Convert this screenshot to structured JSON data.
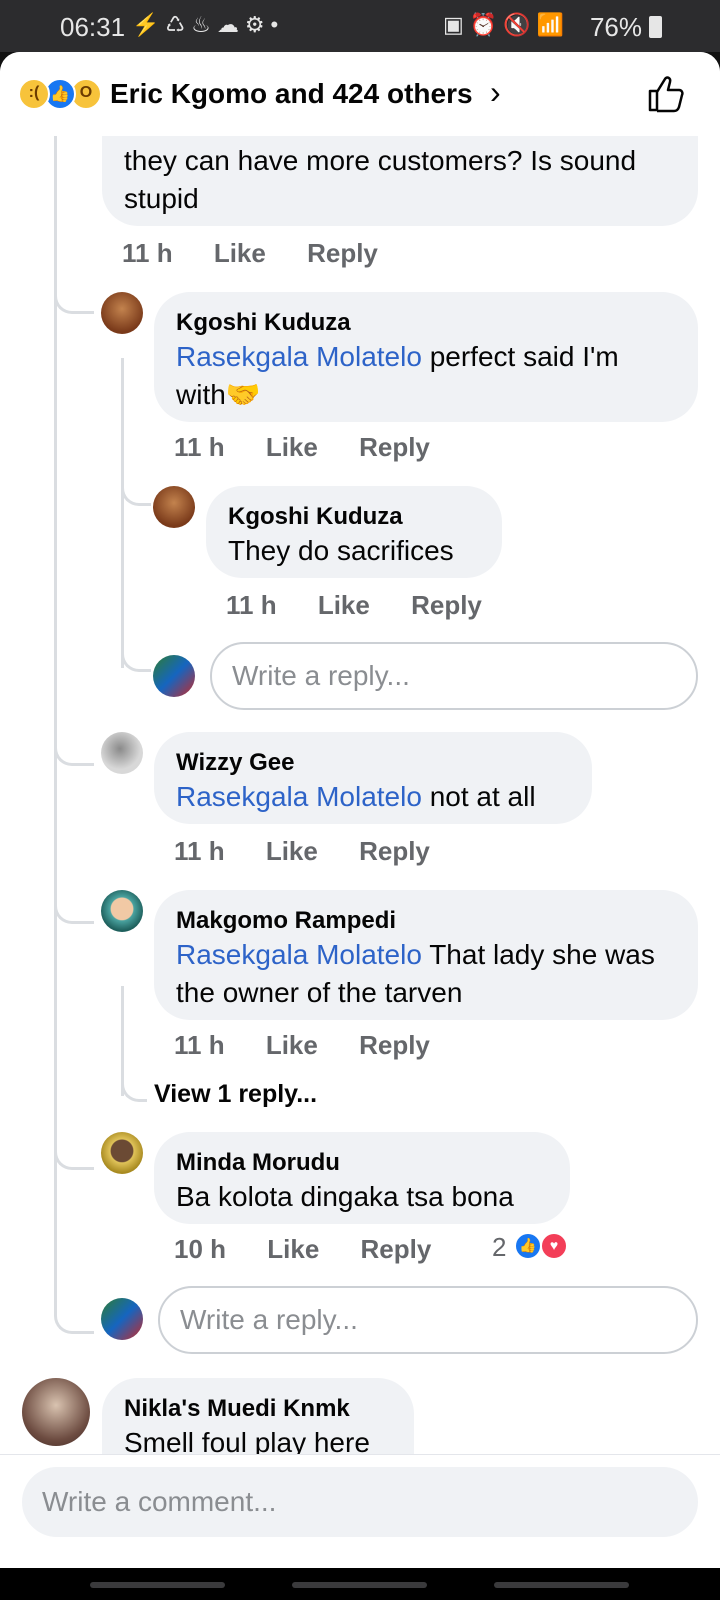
{
  "status_bar": {
    "time": "06:31",
    "left_icons": "⚡♺♨☁⚙•",
    "right_icons": "▣⏰🔇📶",
    "battery": "76%"
  },
  "header": {
    "reactions": [
      "sad",
      "like",
      "wow"
    ],
    "title": "Eric Kgomo and 424 others",
    "chevron": "›"
  },
  "comments": {
    "c0": {
      "text": "they can have more customers? Is sound stupid",
      "time": "11 h",
      "like": "Like",
      "reply": "Reply"
    },
    "c1": {
      "author": "Kgoshi Kuduza",
      "mention": "Rasekgala Molatelo",
      "text": " perfect said I'm with🤝",
      "time": "11 h",
      "like": "Like",
      "reply": "Reply"
    },
    "c2": {
      "author": "Kgoshi Kuduza",
      "text": "They do sacrifices",
      "time": "11 h",
      "like": "Like",
      "reply": "Reply"
    },
    "reply_box_1": {
      "placeholder": "Write a reply..."
    },
    "c3": {
      "author": "Wizzy Gee",
      "mention": "Rasekgala Molatelo",
      "text": " not at all",
      "time": "11 h",
      "like": "Like",
      "reply": "Reply"
    },
    "c4": {
      "author": "Makgomo Rampedi",
      "mention": "Rasekgala Molatelo",
      "text": " That lady she was the owner of the tarven",
      "time": "11 h",
      "like": "Like",
      "reply": "Reply"
    },
    "view_replies": "View 1 reply...",
    "c5": {
      "author": "Minda Morudu",
      "text": "Ba kolota dingaka tsa bona",
      "time": "10 h",
      "like": "Like",
      "reply": "Reply",
      "reaction_count": "2",
      "reactions": [
        "like",
        "love"
      ]
    },
    "reply_box_2": {
      "placeholder": "Write a reply..."
    },
    "c6": {
      "author": "Nikla's Muedi Knmk",
      "text": "Smell foul play here"
    }
  },
  "footer": {
    "placeholder": "Write a comment..."
  },
  "colors": {
    "mention": "#2d63c8",
    "bubble": "#f0f2f5",
    "like_blue": "#1877f2",
    "love_red": "#f33e58"
  }
}
